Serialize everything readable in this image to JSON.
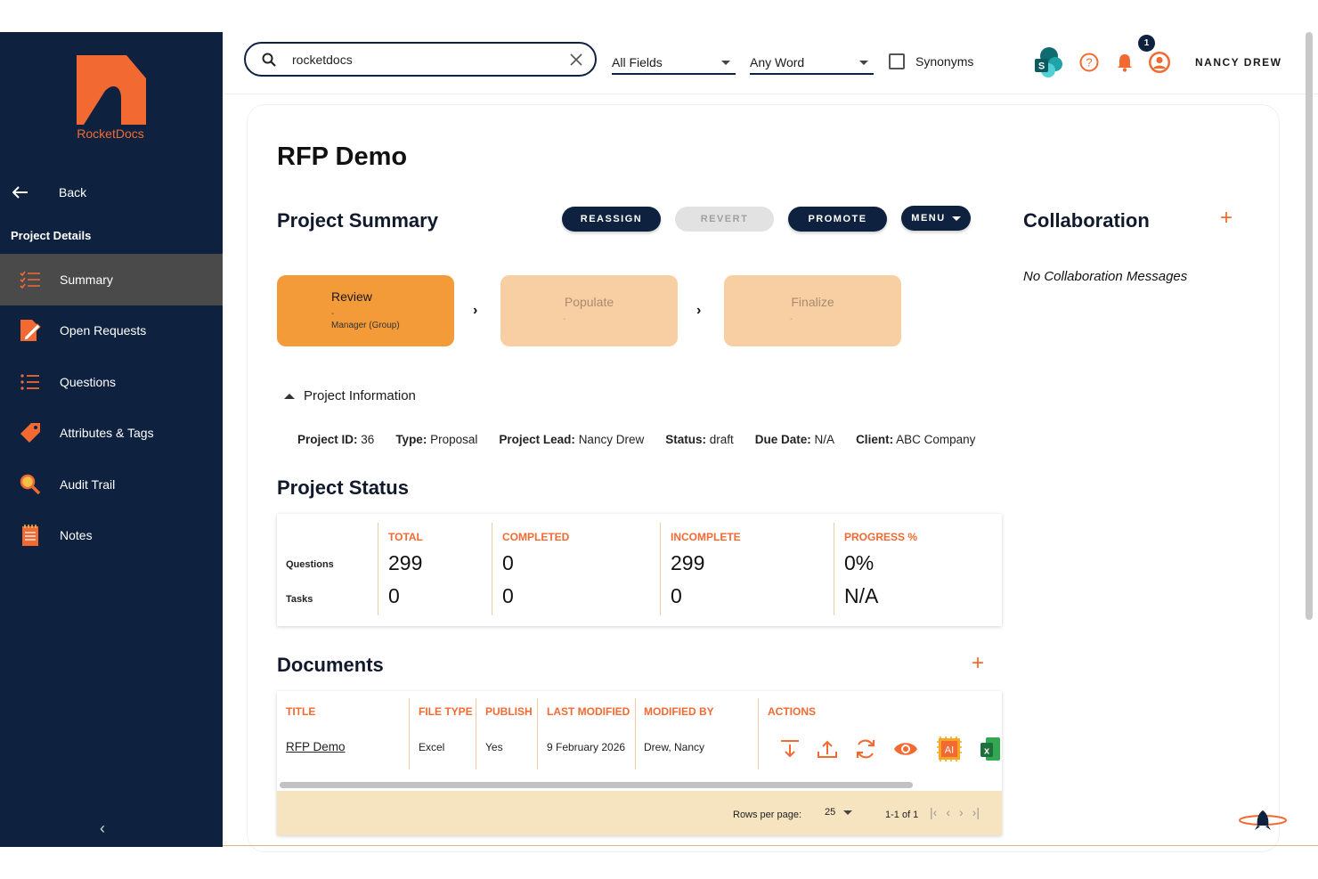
{
  "brand": {
    "name": "RocketDocs",
    "accent": "#f26a32",
    "navy": "#0e2240"
  },
  "sidebar": {
    "back_label": "Back",
    "section_label": "Project Details",
    "items": [
      {
        "label": "Summary",
        "icon": "checklist-icon",
        "active": true
      },
      {
        "label": "Open Requests",
        "icon": "edit-document-icon"
      },
      {
        "label": "Questions",
        "icon": "list-icon"
      },
      {
        "label": "Attributes & Tags",
        "icon": "tag-icon"
      },
      {
        "label": "Audit Trail",
        "icon": "magnifier-icon"
      },
      {
        "label": "Notes",
        "icon": "notepad-icon"
      }
    ],
    "collapse_icon": "chevron-left-icon"
  },
  "search": {
    "value": "rocketdocs",
    "field_scope": "All Fields",
    "match_mode": "Any Word",
    "synonyms_label": "Synonyms",
    "synonyms_checked": false
  },
  "header": {
    "notification_count": "1",
    "user_name": "NANCY DREW"
  },
  "page": {
    "title": "RFP Demo"
  },
  "summary": {
    "heading": "Project Summary",
    "buttons": {
      "reassign": "REASSIGN",
      "revert": "REVERT",
      "promote": "PROMOTE",
      "menu": "MENU"
    },
    "stages": [
      {
        "title": "Review",
        "dash": "-",
        "subtitle": "Manager (Group)",
        "state": "active"
      },
      {
        "title": "Populate",
        "dash": "-",
        "state": "pending"
      },
      {
        "title": "Finalize",
        "dash": "-",
        "state": "pending"
      }
    ]
  },
  "project_info": {
    "toggle_label": "Project Information",
    "fields": [
      {
        "label": "Project ID:",
        "value": "36"
      },
      {
        "label": "Type:",
        "value": "Proposal"
      },
      {
        "label": "Project Lead:",
        "value": "Nancy Drew"
      },
      {
        "label": "Status:",
        "value": "draft"
      },
      {
        "label": "Due Date:",
        "value": "N/A"
      },
      {
        "label": "Client:",
        "value": "ABC Company"
      }
    ]
  },
  "project_status": {
    "heading": "Project Status",
    "row_labels": [
      "Questions",
      "Tasks"
    ],
    "columns": [
      {
        "header": "TOTAL",
        "values": [
          "299",
          "0"
        ]
      },
      {
        "header": "COMPLETED",
        "values": [
          "0",
          "0"
        ]
      },
      {
        "header": "INCOMPLETE",
        "values": [
          "299",
          "0"
        ]
      },
      {
        "header": "PROGRESS %",
        "values": [
          "0%",
          "N/A"
        ]
      }
    ]
  },
  "documents": {
    "heading": "Documents",
    "columns": [
      "TITLE",
      "FILE TYPE",
      "PUBLISH",
      "LAST MODIFIED",
      "MODIFIED BY",
      "ACTIONS"
    ],
    "rows": [
      {
        "title": "RFP Demo",
        "file_type": "Excel",
        "publish": "Yes",
        "last_modified": "9 February 2026",
        "modified_by": "Drew, Nancy"
      }
    ],
    "action_icons": [
      "download-icon",
      "upload-icon",
      "refresh-icon",
      "eye-icon",
      "ai-chip-icon",
      "excel-icon"
    ],
    "ai_label": "AI",
    "excel_label": "x",
    "pagination": {
      "rows_per_page_label": "Rows per page:",
      "rows_per_page": "25",
      "range": "1-1 of 1"
    }
  },
  "collaboration": {
    "heading": "Collaboration",
    "empty_text": "No Collaboration Messages"
  }
}
